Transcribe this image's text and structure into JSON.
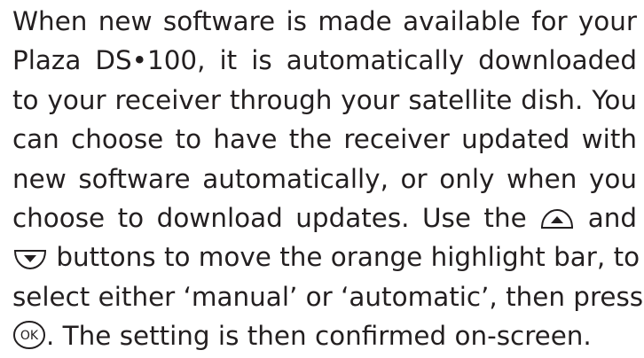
{
  "paragraph": {
    "line1": "When new software is made available for your",
    "line2": "Plaza DS•100, it is automatically downloaded",
    "line3": "to your receiver through  your satellite dish. You",
    "line4": "can choose to have the receiver updated with",
    "line5": "new software automatically, or only when you",
    "line6a": "choose to download updates. Use the",
    "line6b": "and",
    "line7": "buttons to move the orange highlight bar, to",
    "line8": "select either ‘manual’ or ‘automatic’, then press",
    "line9": ". The setting is then confirmed on-screen."
  },
  "buttons": {
    "ok_label": "OK"
  },
  "icons": {
    "up": "up-arrow-button-icon",
    "down": "down-arrow-button-icon",
    "ok": "ok-button-icon"
  },
  "colors": {
    "text": "#231f20",
    "icon_stroke": "#231f20"
  }
}
